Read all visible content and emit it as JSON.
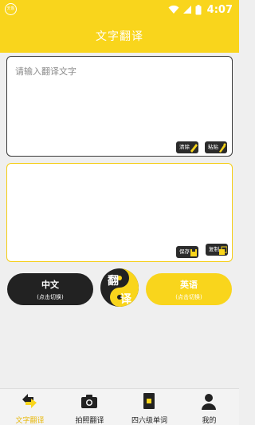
{
  "status_bar": {
    "app_badge": "天象",
    "time": "4:07"
  },
  "header": {
    "title": "文字翻译"
  },
  "input": {
    "placeholder": "请输入翻译文字",
    "clear_label": "清除",
    "paste_label": "粘贴"
  },
  "output": {
    "save_label": "保存",
    "copy_label": "复制"
  },
  "languages": {
    "source_name": "中文",
    "source_hint": "(点击切换)",
    "translate_char_top": "翻",
    "translate_char_bottom": "译",
    "target_name": "英语",
    "target_hint": "(点击切换)"
  },
  "tabs": [
    {
      "label": "文字翻译",
      "icon": "text-translate-icon",
      "active": true
    },
    {
      "label": "拍照翻译",
      "icon": "camera-icon",
      "active": false
    },
    {
      "label": "四六级单词",
      "icon": "word-book-icon",
      "active": false
    },
    {
      "label": "我的",
      "icon": "person-icon",
      "active": false
    }
  ],
  "colors": {
    "accent": "#f9d51c",
    "dark": "#222222",
    "background": "#efefef"
  }
}
